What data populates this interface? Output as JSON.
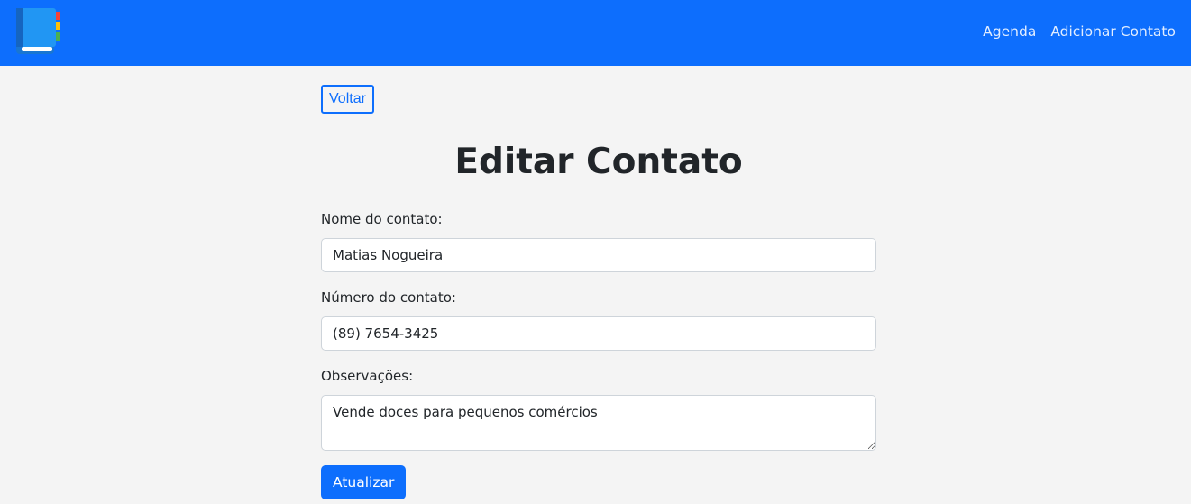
{
  "navbar": {
    "logo_icon": "address-book-icon",
    "colors": {
      "background": "#0d6efd",
      "logo_book": "#2196f3",
      "logo_tab_red": "#f44336",
      "logo_tab_yellow": "#ffc107",
      "logo_tab_green": "#4caf50"
    },
    "links": [
      {
        "label": "Agenda"
      },
      {
        "label": "Adicionar Contato"
      }
    ]
  },
  "page": {
    "back_label": "Voltar",
    "title": "Editar Contato"
  },
  "form": {
    "name": {
      "label": "Nome do contato:",
      "value": "Matias Nogueira"
    },
    "number": {
      "label": "Número do contato:",
      "value": "(89) 7654-3425"
    },
    "notes": {
      "label": "Observações:",
      "value": "Vende doces para pequenos comércios"
    },
    "submit_label": "Atualizar"
  },
  "theme": {
    "primary": "#0d6efd",
    "page_background": "#f4f4f4"
  }
}
